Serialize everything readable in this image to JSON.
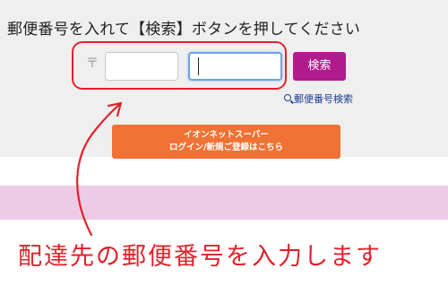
{
  "instruction": "郵便番号を入れて【検索】ボタンを押してください",
  "postal": {
    "mark": "〒",
    "zip1_value": "",
    "zip2_value": ""
  },
  "search_button_label": "検索",
  "postal_lookup_link": "郵便番号検索",
  "login_button": {
    "line1": "イオンネットスーパー",
    "line2": "ログイン/新規ご登録はこちら"
  },
  "annotation": {
    "caption": "配達先の郵便番号を入力します",
    "color": "#e0222b"
  },
  "colors": {
    "search_button": "#b01b8e",
    "login_button": "#f07234",
    "pink_band": "#eecbe4",
    "link": "#1a3f8f"
  }
}
